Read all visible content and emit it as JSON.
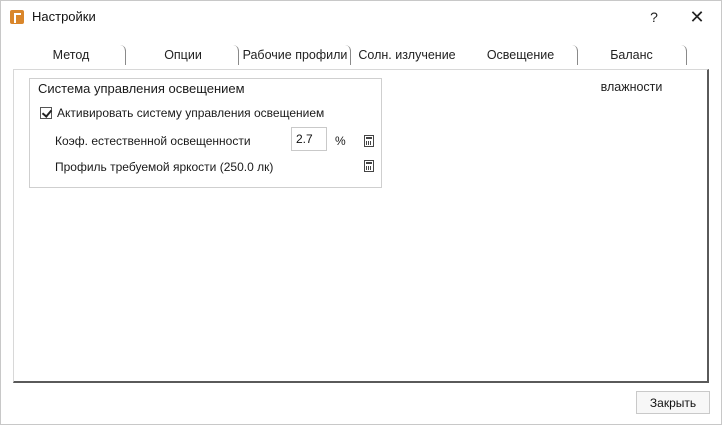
{
  "window": {
    "title": "Настройки",
    "help_label": "?",
    "close_glyph": "✕"
  },
  "tabs": [
    {
      "label": "Метод"
    },
    {
      "label": "Опции"
    },
    {
      "label": "Рабочие профили"
    },
    {
      "label": "Солн. излучение"
    },
    {
      "label": "Освещение",
      "active": true
    },
    {
      "label": "Баланс влажности"
    }
  ],
  "lighting": {
    "group_title": "Система управления освещением",
    "activate_label": "Активировать систему управления освещением",
    "activate_checked": true,
    "coef_label": "Коэф. естественной освещенности",
    "coef_value": "2.7",
    "coef_unit": "%",
    "profile_label": "Профиль требуемой яркости (250.0 лк)",
    "calculator_icon": "calculator-icon"
  },
  "footer": {
    "close_label": "Закрыть"
  }
}
